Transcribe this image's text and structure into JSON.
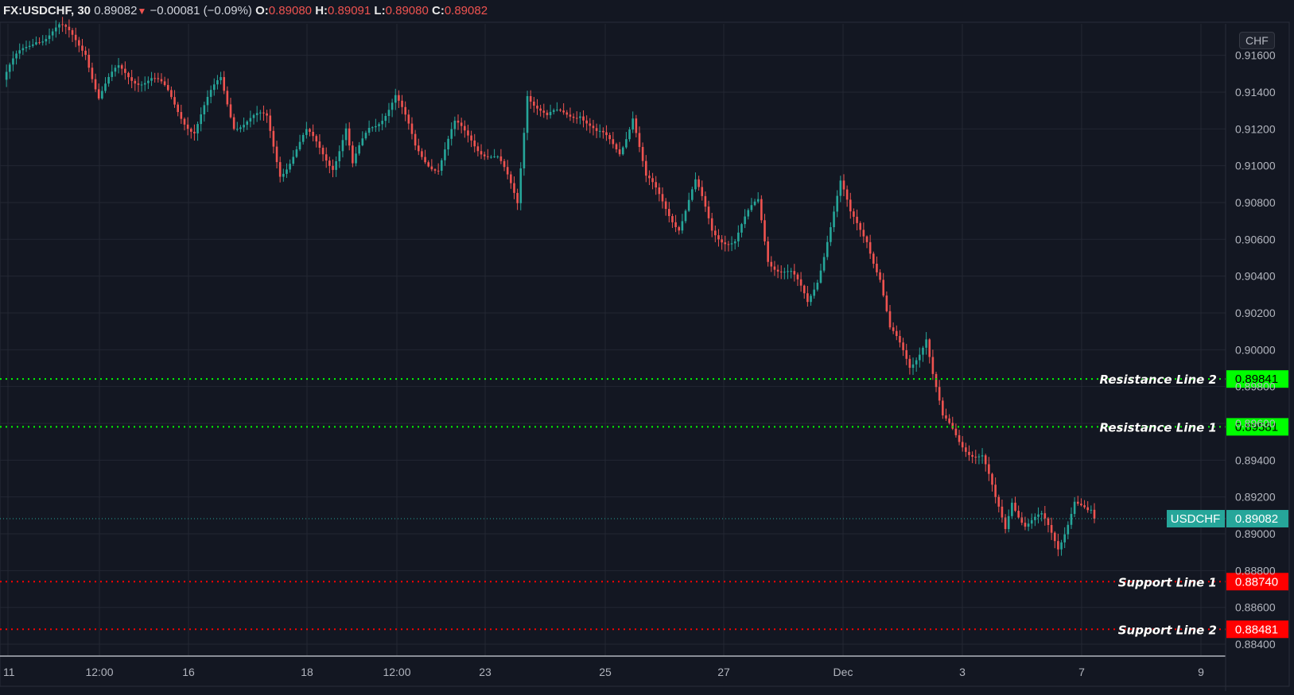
{
  "header": {
    "symbol": "FX:USDCHF, 30",
    "last": "0.89082",
    "change_arrow": "down-triangle-icon",
    "change": "−0.00081 (−0.09%)",
    "o_label": "O:",
    "o": "0.89080",
    "h_label": "H:",
    "h": "0.89091",
    "l_label": "L:",
    "l": "0.89080",
    "c_label": "C:",
    "c": "0.89082"
  },
  "currency_unit": "CHF",
  "colors": {
    "background": "#131722",
    "up": "#26a69a",
    "down": "#ef5350",
    "resistance": "#00ff00",
    "support": "#ff0000",
    "last_price": "#26a69a",
    "grid": "#232733"
  },
  "chart_data": {
    "type": "candlestick",
    "symbol": "USDCHF",
    "interval_minutes": 30,
    "ylim": [
      0.8835,
      0.9164
    ],
    "y_ticks": [
      "0.91600",
      "0.91400",
      "0.91200",
      "0.91000",
      "0.90800",
      "0.90600",
      "0.90400",
      "0.90200",
      "0.90000",
      "0.89800",
      "0.89600",
      "0.89400",
      "0.89200",
      "0.89000",
      "0.88800",
      "0.88600",
      "0.88400"
    ],
    "x_ticks": [
      "11",
      "12:00",
      "16",
      "18",
      "12:00",
      "23",
      "25",
      "27",
      "Dec",
      "3",
      "7",
      "9"
    ],
    "grid": true,
    "price_path": [
      [
        0,
        0.91467
      ],
      [
        10,
        0.91711
      ],
      [
        17,
        0.91733
      ],
      [
        25,
        0.91644
      ],
      [
        29,
        0.91378
      ],
      [
        35,
        0.91511
      ],
      [
        45,
        0.91467
      ],
      [
        50,
        0.91378
      ],
      [
        58,
        0.912
      ],
      [
        66,
        0.91467
      ],
      [
        70,
        0.91244
      ],
      [
        80,
        0.91244
      ],
      [
        84,
        0.90978
      ],
      [
        92,
        0.91156
      ],
      [
        100,
        0.91022
      ],
      [
        104,
        0.912
      ],
      [
        106,
        0.90978
      ],
      [
        111,
        0.912
      ],
      [
        119,
        0.91378
      ],
      [
        125,
        0.91089
      ],
      [
        132,
        0.91
      ],
      [
        137,
        0.912
      ],
      [
        142,
        0.91156
      ],
      [
        150,
        0.91022
      ],
      [
        156,
        0.908
      ],
      [
        159,
        0.91422
      ],
      [
        165,
        0.91244
      ],
      [
        175,
        0.91311
      ],
      [
        180,
        0.91156
      ],
      [
        187,
        0.91089
      ],
      [
        191,
        0.91289
      ],
      [
        195,
        0.90911
      ],
      [
        200,
        0.908
      ],
      [
        205,
        0.90689
      ],
      [
        210,
        0.90889
      ],
      [
        215,
        0.90644
      ],
      [
        222,
        0.906
      ],
      [
        229,
        0.908
      ],
      [
        232,
        0.90511
      ],
      [
        239,
        0.904
      ],
      [
        244,
        0.90244
      ],
      [
        247,
        0.904
      ],
      [
        250,
        0.90622
      ],
      [
        254,
        0.90889
      ],
      [
        257,
        0.90711
      ],
      [
        262,
        0.90622
      ],
      [
        266,
        0.904
      ],
      [
        269,
        0.90089
      ],
      [
        275,
        0.89911
      ],
      [
        280,
        0.90089
      ],
      [
        282,
        0.89867
      ],
      [
        285,
        0.896
      ],
      [
        290,
        0.89511
      ],
      [
        297,
        0.89422
      ],
      [
        301,
        0.89156
      ],
      [
        304,
        0.89022
      ],
      [
        306,
        0.892
      ],
      [
        310,
        0.89067
      ],
      [
        315,
        0.89067
      ],
      [
        320,
        0.88933
      ],
      [
        325,
        0.892
      ],
      [
        329,
        0.89089
      ],
      [
        331,
        0.89082
      ]
    ],
    "last_price": 0.89082,
    "horizontal_lines": [
      {
        "label": "Resistance Line 2",
        "value": 0.89841,
        "value_text": "0.89841",
        "color": "#00ff00"
      },
      {
        "label": "Resistance Line 1",
        "value": 0.89581,
        "value_text": "0.89581",
        "color": "#00ff00"
      },
      {
        "label": "Support Line 1",
        "value": 0.8874,
        "value_text": "0.88740",
        "color": "#ff0000"
      },
      {
        "label": "Support Line 2",
        "value": 0.88481,
        "value_text": "0.88481",
        "color": "#ff0000"
      }
    ]
  }
}
